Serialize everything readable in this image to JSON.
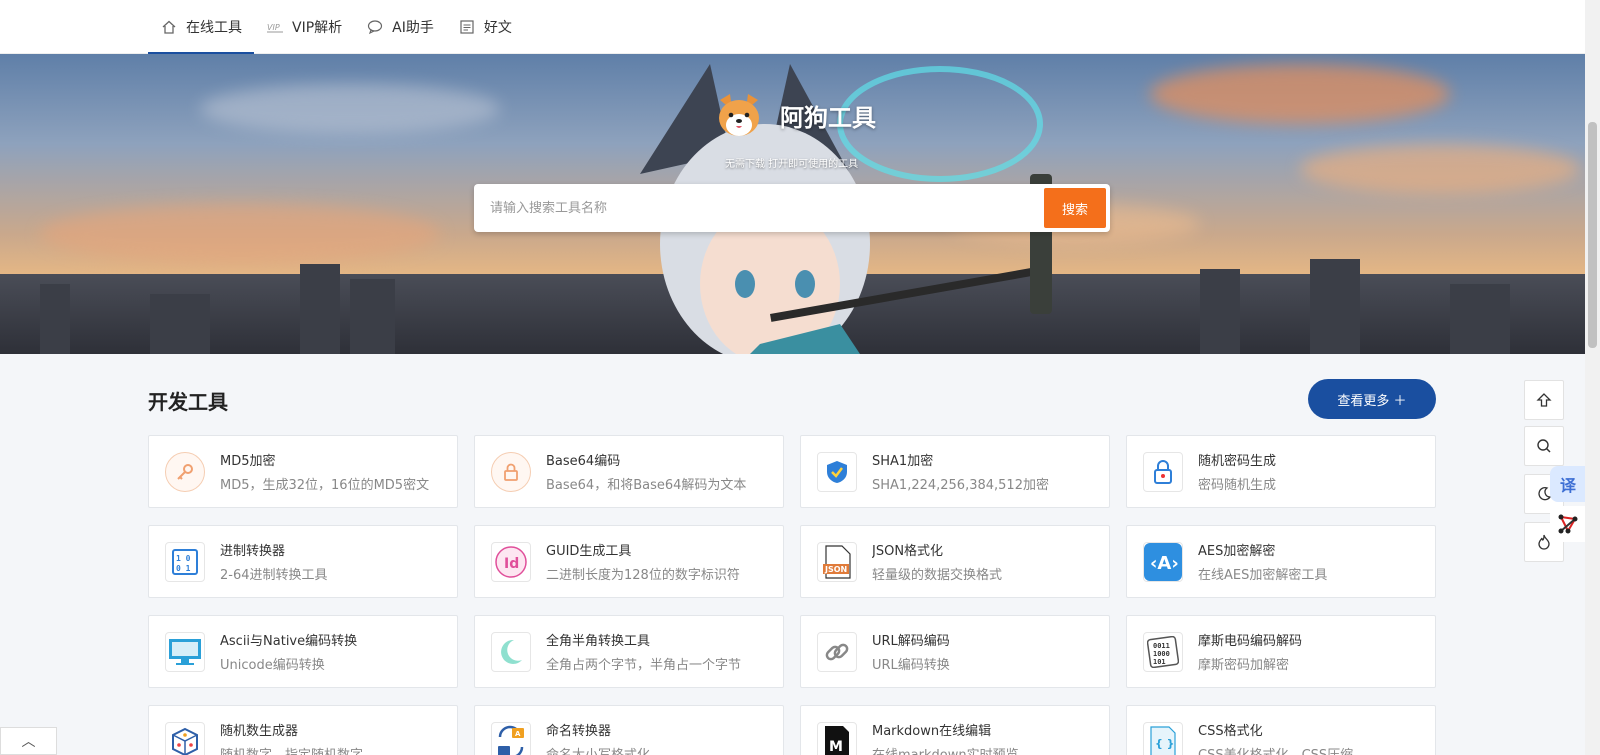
{
  "nav": {
    "items": [
      {
        "label": "在线工具",
        "icon": "home-icon",
        "active": true
      },
      {
        "label": "VIP解析",
        "icon": "vip-icon",
        "active": false
      },
      {
        "label": "AI助手",
        "icon": "chat-icon",
        "active": false
      },
      {
        "label": "好文",
        "icon": "article-icon",
        "active": false
      }
    ]
  },
  "hero": {
    "title": "阿狗工具",
    "subtitle": "无需下载 打开即可使用的工具",
    "search_placeholder": "请输入搜索工具名称",
    "search_button": "搜索"
  },
  "section": {
    "title": "开发工具",
    "more_button": "查看更多 ＋"
  },
  "tools": [
    {
      "title": "MD5加密",
      "desc": "MD5，生成32位，16位的MD5密文",
      "icon": "key-icon",
      "color": "#f0a070"
    },
    {
      "title": "Base64编码",
      "desc": "Base64，和将Base64解码为文本",
      "icon": "lock-icon",
      "color": "#f0a070"
    },
    {
      "title": "SHA1加密",
      "desc": "SHA1,224,256,384,512加密",
      "icon": "shield-check-icon",
      "color": "#2e7fd8"
    },
    {
      "title": "随机密码生成",
      "desc": "密码随机生成",
      "icon": "padlock-icon",
      "color": "#2e7fd8"
    },
    {
      "title": "进制转换器",
      "desc": "2-64进制转换工具",
      "icon": "binary-icon",
      "color": "#2e7fd8"
    },
    {
      "title": "GUID生成工具",
      "desc": "二进制长度为128位的数字标识符",
      "icon": "id-icon",
      "color": "#e04f9a"
    },
    {
      "title": "JSON格式化",
      "desc": "轻量级的数据交换格式",
      "icon": "json-file-icon",
      "color": "#e07b3a"
    },
    {
      "title": "AES加密解密",
      "desc": "在线AES加密解密工具",
      "icon": "angle-brackets-icon",
      "color": "#2e7fd8"
    },
    {
      "title": "Ascii与Native编码转换",
      "desc": "Unicode编码转换",
      "icon": "monitor-icon",
      "color": "#2aa0d8"
    },
    {
      "title": "全角半角转换工具",
      "desc": "全角占两个字节，半角占一个字节",
      "icon": "moon-icon",
      "color": "#7fd8c8"
    },
    {
      "title": "URL解码编码",
      "desc": "URL编码转换",
      "icon": "link-icon",
      "color": "#888888"
    },
    {
      "title": "摩斯电码编码解码",
      "desc": "摩斯密码加解密",
      "icon": "morse-icon",
      "color": "#555555"
    },
    {
      "title": "随机数生成器",
      "desc": "随机数字，指定随机数字",
      "icon": "dice-icon",
      "color": "#2e5fa8"
    },
    {
      "title": "命名转换器",
      "desc": "命名大小写格式化",
      "icon": "convert-icon",
      "color": "#2e5fa8"
    },
    {
      "title": "Markdown在线编辑",
      "desc": "在线markdown实时预览",
      "icon": "markdown-icon",
      "color": "#111111"
    },
    {
      "title": "CSS格式化",
      "desc": "CSS美化格式化，CSS压缩",
      "icon": "css-icon",
      "color": "#2aa0d8"
    }
  ],
  "float": {
    "top": "⇧",
    "search": "⌕",
    "theme": "☾",
    "fire": "♨",
    "translate": "译"
  },
  "collapse": "︿"
}
